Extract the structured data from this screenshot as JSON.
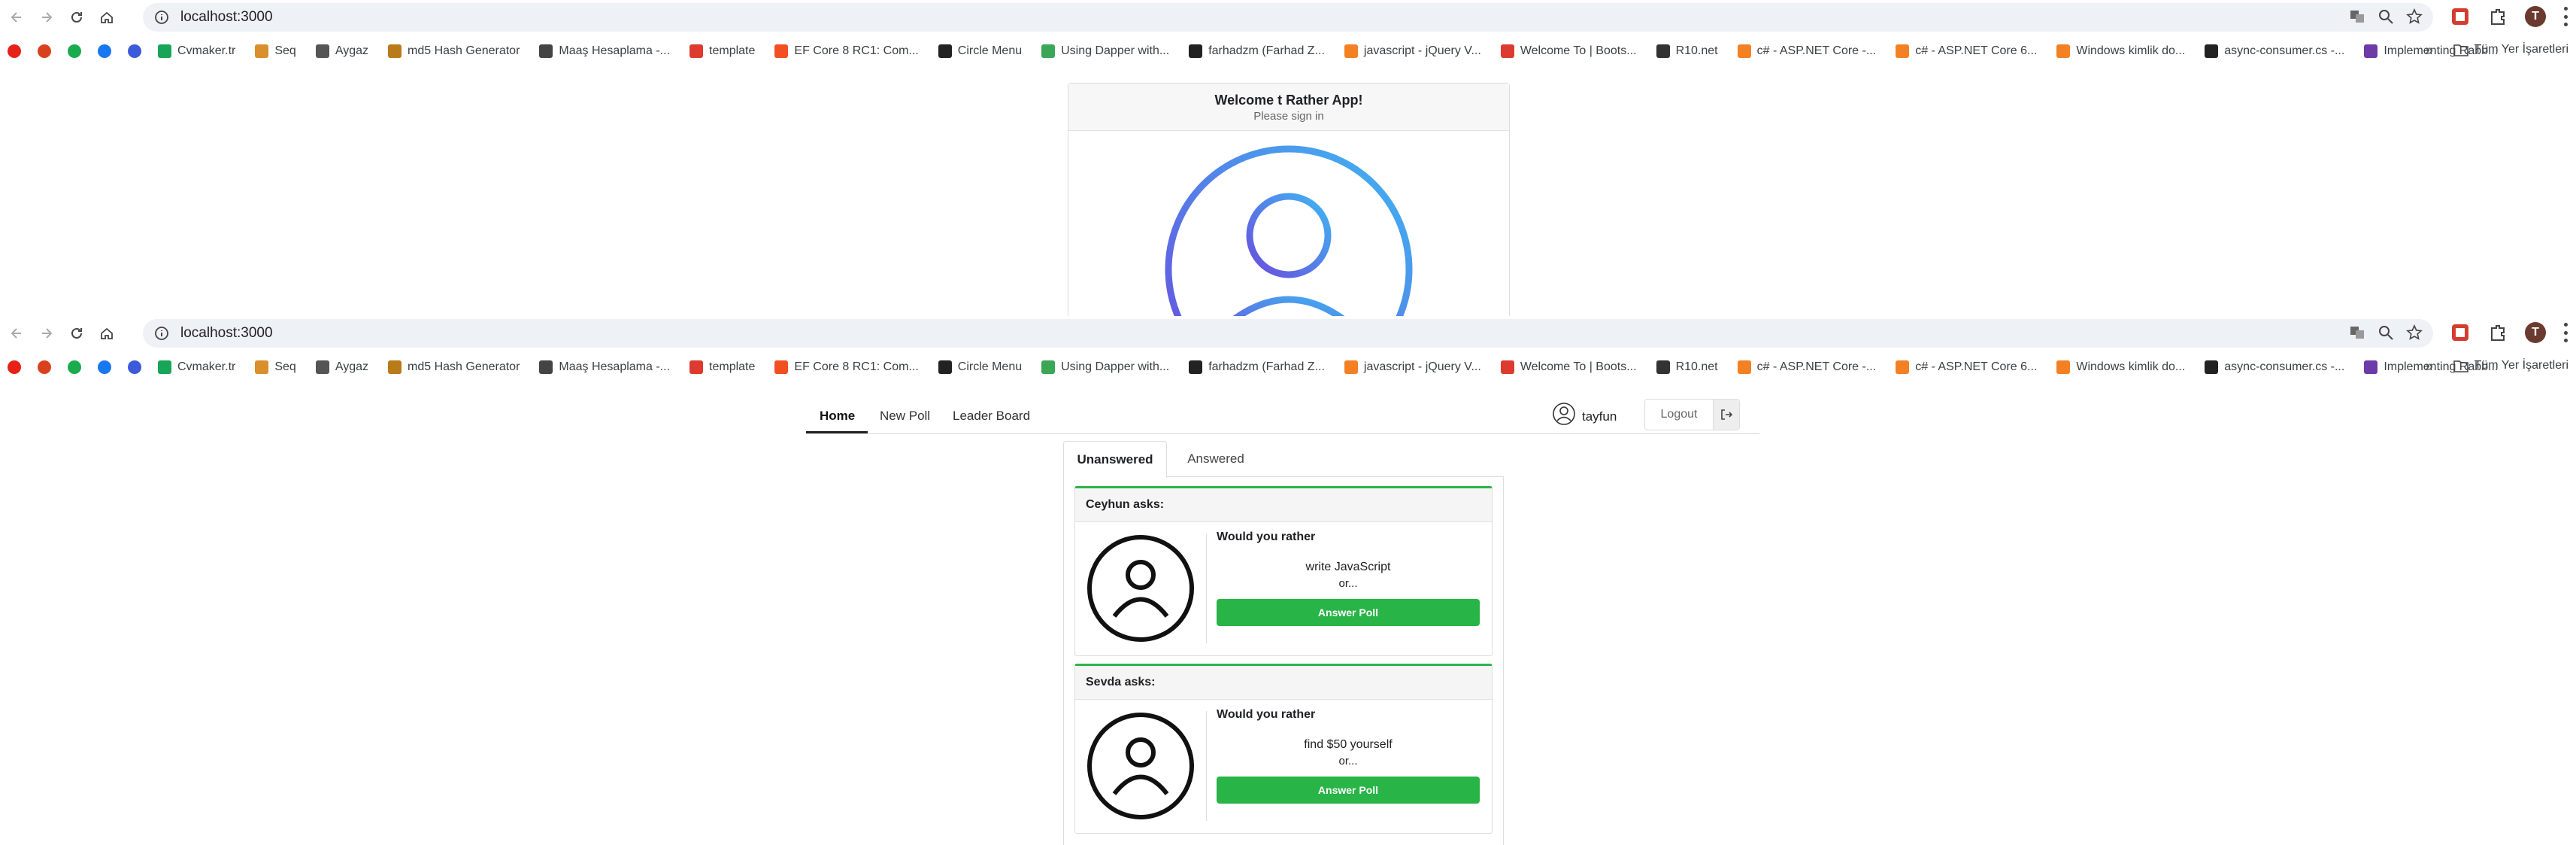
{
  "browser": {
    "url": "localhost:3000",
    "profile_initial": "T",
    "bookmarks": [
      {
        "label": "",
        "color": "#e62117"
      },
      {
        "label": "",
        "color": "#d9411e"
      },
      {
        "label": "",
        "color": "#1aab4f"
      },
      {
        "label": "",
        "color": "#1877f2"
      },
      {
        "label": "",
        "color": "#3b5bdb"
      },
      {
        "label": "Cvmaker.tr",
        "color": "#18a558"
      },
      {
        "label": "Seq",
        "color": "#d98f2b"
      },
      {
        "label": "Aygaz",
        "color": "#555555"
      },
      {
        "label": "md5 Hash Generator",
        "color": "#b97a1a"
      },
      {
        "label": "Maaş Hesaplama -...",
        "color": "#444444"
      },
      {
        "label": "template",
        "color": "#dd3b2f"
      },
      {
        "label": "EF Core 8 RC1: Com...",
        "color": "#f25022"
      },
      {
        "label": "Circle Menu",
        "color": "#222222"
      },
      {
        "label": "Using Dapper with...",
        "color": "#3aa757"
      },
      {
        "label": "farhadzm (Farhad Z...",
        "color": "#222222"
      },
      {
        "label": "javascript - jQuery V...",
        "color": "#f48024"
      },
      {
        "label": "Welcome To | Boots...",
        "color": "#dd3b2f"
      },
      {
        "label": "R10.net",
        "color": "#333333"
      },
      {
        "label": "c# - ASP.NET Core -...",
        "color": "#f48024"
      },
      {
        "label": "c# - ASP.NET Core 6...",
        "color": "#f48024"
      },
      {
        "label": "Windows kimlik do...",
        "color": "#f48024"
      },
      {
        "label": "async-consumer.cs -...",
        "color": "#222222"
      },
      {
        "label": "Implementing Rabb...",
        "color": "#6d3aa8"
      }
    ],
    "all_bookmarks_label": "Tüm Yer İşaretleri",
    "more_chevron": "»"
  },
  "signin": {
    "title": "Welcome t Rather App!",
    "subtitle": "Please sign in"
  },
  "nav": {
    "items": [
      "Home",
      "New Poll",
      "Leader Board"
    ],
    "username": "tayfun",
    "logout_label": "Logout"
  },
  "tabs": [
    "Unanswered",
    "Answered"
  ],
  "polls": [
    {
      "asker": "Ceyhun asks:",
      "question": "Would you rather",
      "option": "write JavaScript",
      "or": "or...",
      "button": "Answer Poll"
    },
    {
      "asker": "Sevda asks:",
      "question": "Would you rather",
      "option": "find $50 yourself",
      "or": "or...",
      "button": "Answer Poll"
    }
  ],
  "colors": {
    "accent_green": "#28b446",
    "logo_gradient_start": "#6a4cde",
    "logo_gradient_end": "#3fb6f2"
  }
}
